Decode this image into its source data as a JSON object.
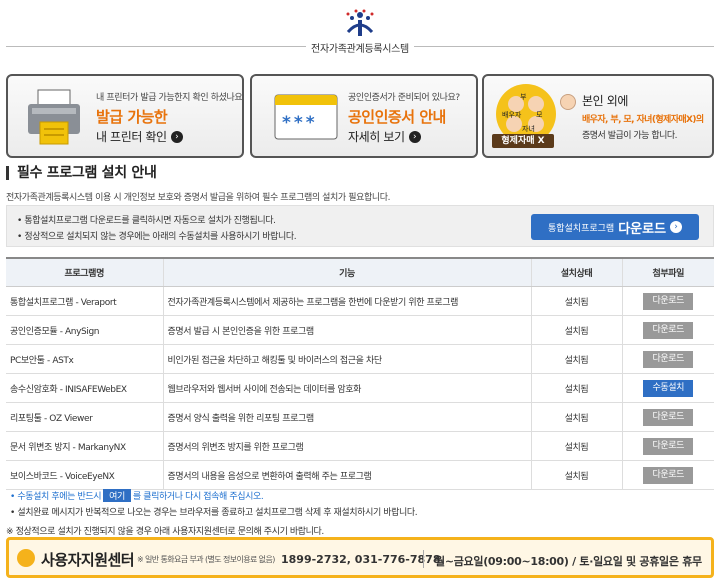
{
  "header": {
    "title": "전자가족관계등록시스템"
  },
  "cards": [
    {
      "small": "내 프린터가 발급 가능한지 확인 하셨나요?",
      "big": "발급 가능한",
      "sub": "내 프린터 확인"
    },
    {
      "small": "공인인증서가 준비되어 있나요?",
      "big": "공인인증서 안내",
      "sub": "자세히 보기",
      "code": "***"
    },
    {
      "small": "본인 외에",
      "big": "배우자, 부, 모, 자녀(형제자매X)의",
      "sub": "증명서 발급이 가능 합니다.",
      "badge": "형제자매 X",
      "figure_labels": [
        "배우자",
        "부",
        "모",
        "자녀"
      ]
    }
  ],
  "section": {
    "title": "필수 프로그램 설치 안내",
    "desc": "전자가족관계등록시스템 이용 시 개인정보 보호와 증명서 발급을 위하여 필수 프로그램의 설치가 필요합니다."
  },
  "notice": {
    "items": [
      "통합설치프로그램 다운로드를 클릭하시면 자동으로 설치가 진행됩니다.",
      "정상적으로 설치되지 않는 경우에는 아래의 수동설치를 사용하시기 바랍니다."
    ],
    "download_small": "통합설치프로그램",
    "download_big": "다운로드"
  },
  "table": {
    "headers": [
      "프로그램명",
      "기능",
      "설치상태",
      "첨부파일"
    ],
    "rows": [
      {
        "name": "통합설치프로그램 - Veraport",
        "func": "전자가족관계등록시스템에서 제공하는 프로그램을 한번에 다운받기 위한 프로그램",
        "status": "설치됨",
        "button": "다운로드",
        "blue": false
      },
      {
        "name": "공인인증모듈 - AnySign",
        "func": "증명서 발급 시 본인인증을 위한 프로그램",
        "status": "설치됨",
        "button": "다운로드",
        "blue": false
      },
      {
        "name": "PC보안툴 - ASTx",
        "func": "비인가된 접근을 차단하고 해킹툴 및 바이러스의 접근을 차단",
        "status": "설치됨",
        "button": "다운로드",
        "blue": false
      },
      {
        "name": "송수신암호화 - INISAFEWebEX",
        "func": "웹브라우저와 웹서버 사이에 전송되는 데이터를 암호화",
        "status": "설치됨",
        "button": "수동설치",
        "blue": true
      },
      {
        "name": "리포팅툴 - OZ Viewer",
        "func": "증명서 양식 출력을 위한 리포팅 프로그램",
        "status": "설치됨",
        "button": "다운로드",
        "blue": false
      },
      {
        "name": "문서 위변조 방지 - MarkanyNX",
        "func": "증명서의 위변조 방지를 위한 프로그램",
        "status": "설치됨",
        "button": "다운로드",
        "blue": false
      },
      {
        "name": "보이스바코드 - VoiceEyeNX",
        "func": "증명서의 내용을 음성으로 변환하여 출력해 주는 프로그램",
        "status": "설치됨",
        "button": "다운로드",
        "blue": false
      }
    ]
  },
  "footer": {
    "line1_pre": "수동설치 후에는 반드시",
    "line1_here": "여기",
    "line1_post": "를 클릭하거나 다시 접속해 주십시오.",
    "line2": "설치완료 메시지가 반복적으로 나오는 경우는 브라우저를 종료하고 설치프로그램 삭제 후 재설치하시기 바랍니다.",
    "note": "※ 정상적으로 설치가 진행되지 않을 경우 아래 사용자지원센터로 문의해 주시기 바랍니다."
  },
  "support": {
    "title": "사용자지원센터",
    "desc": "※ 일반 통화요금 부과 (별도 정보이용료 없음)",
    "tel": "1899-2732, 031-776-7878",
    "hours": "월~금요일(09:00~18:00) / 토·일요일 및 공휴일은 휴무"
  },
  "colors": {
    "accent_blue": "#2f6fc4",
    "accent_orange": "#e8730c",
    "support_border": "#f5b21b"
  }
}
